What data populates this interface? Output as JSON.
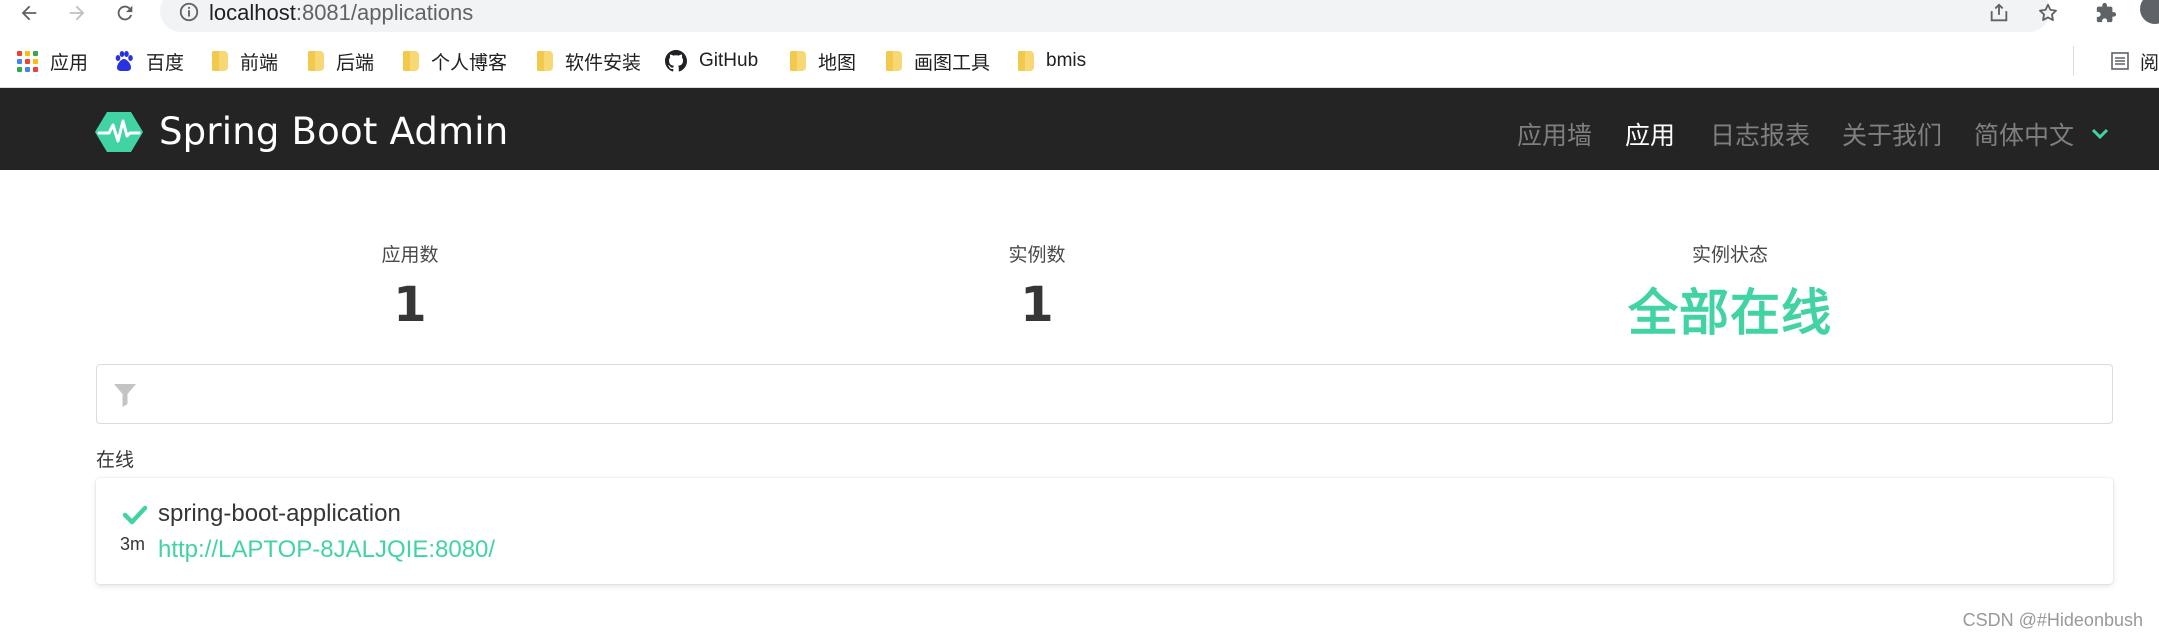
{
  "browser": {
    "url_host": "localhost",
    "url_rest": ":8081/applications",
    "bookmarks": [
      {
        "label": "应用",
        "icon": "apps-grid-icon"
      },
      {
        "label": "百度",
        "icon": "baidu-icon"
      },
      {
        "label": "前端",
        "icon": "folder-icon"
      },
      {
        "label": "后端",
        "icon": "folder-icon"
      },
      {
        "label": "个人博客",
        "icon": "folder-icon"
      },
      {
        "label": "软件安装",
        "icon": "folder-icon"
      },
      {
        "label": "GitHub",
        "icon": "github-icon"
      },
      {
        "label": "地图",
        "icon": "folder-icon"
      },
      {
        "label": "画图工具",
        "icon": "folder-icon"
      },
      {
        "label": "bmis",
        "icon": "folder-icon"
      }
    ],
    "reading_list_label": "阅"
  },
  "navbar": {
    "brand": "Spring Boot Admin",
    "items": [
      {
        "label": "应用墙",
        "active": false
      },
      {
        "label": "应用",
        "active": true
      },
      {
        "label": "日志报表",
        "active": false
      },
      {
        "label": "关于我们",
        "active": false
      }
    ],
    "language": "简体中文"
  },
  "stats": {
    "applications_label": "应用数",
    "applications_value": "1",
    "instances_label": "实例数",
    "instances_value": "1",
    "status_label": "实例状态",
    "status_value": "全部在线"
  },
  "filter": {
    "placeholder": ""
  },
  "groups": [
    {
      "label": "在线",
      "applications": [
        {
          "name": "spring-boot-application",
          "url": "http://LAPTOP-8JALJQIE:8080/",
          "age": "3m",
          "status": "UP"
        }
      ]
    }
  ],
  "watermark": "CSDN @#Hideonbush",
  "colors": {
    "accent": "#42d3a5",
    "navbar_bg": "#242424",
    "nav_inactive": "#7f7f7f"
  }
}
